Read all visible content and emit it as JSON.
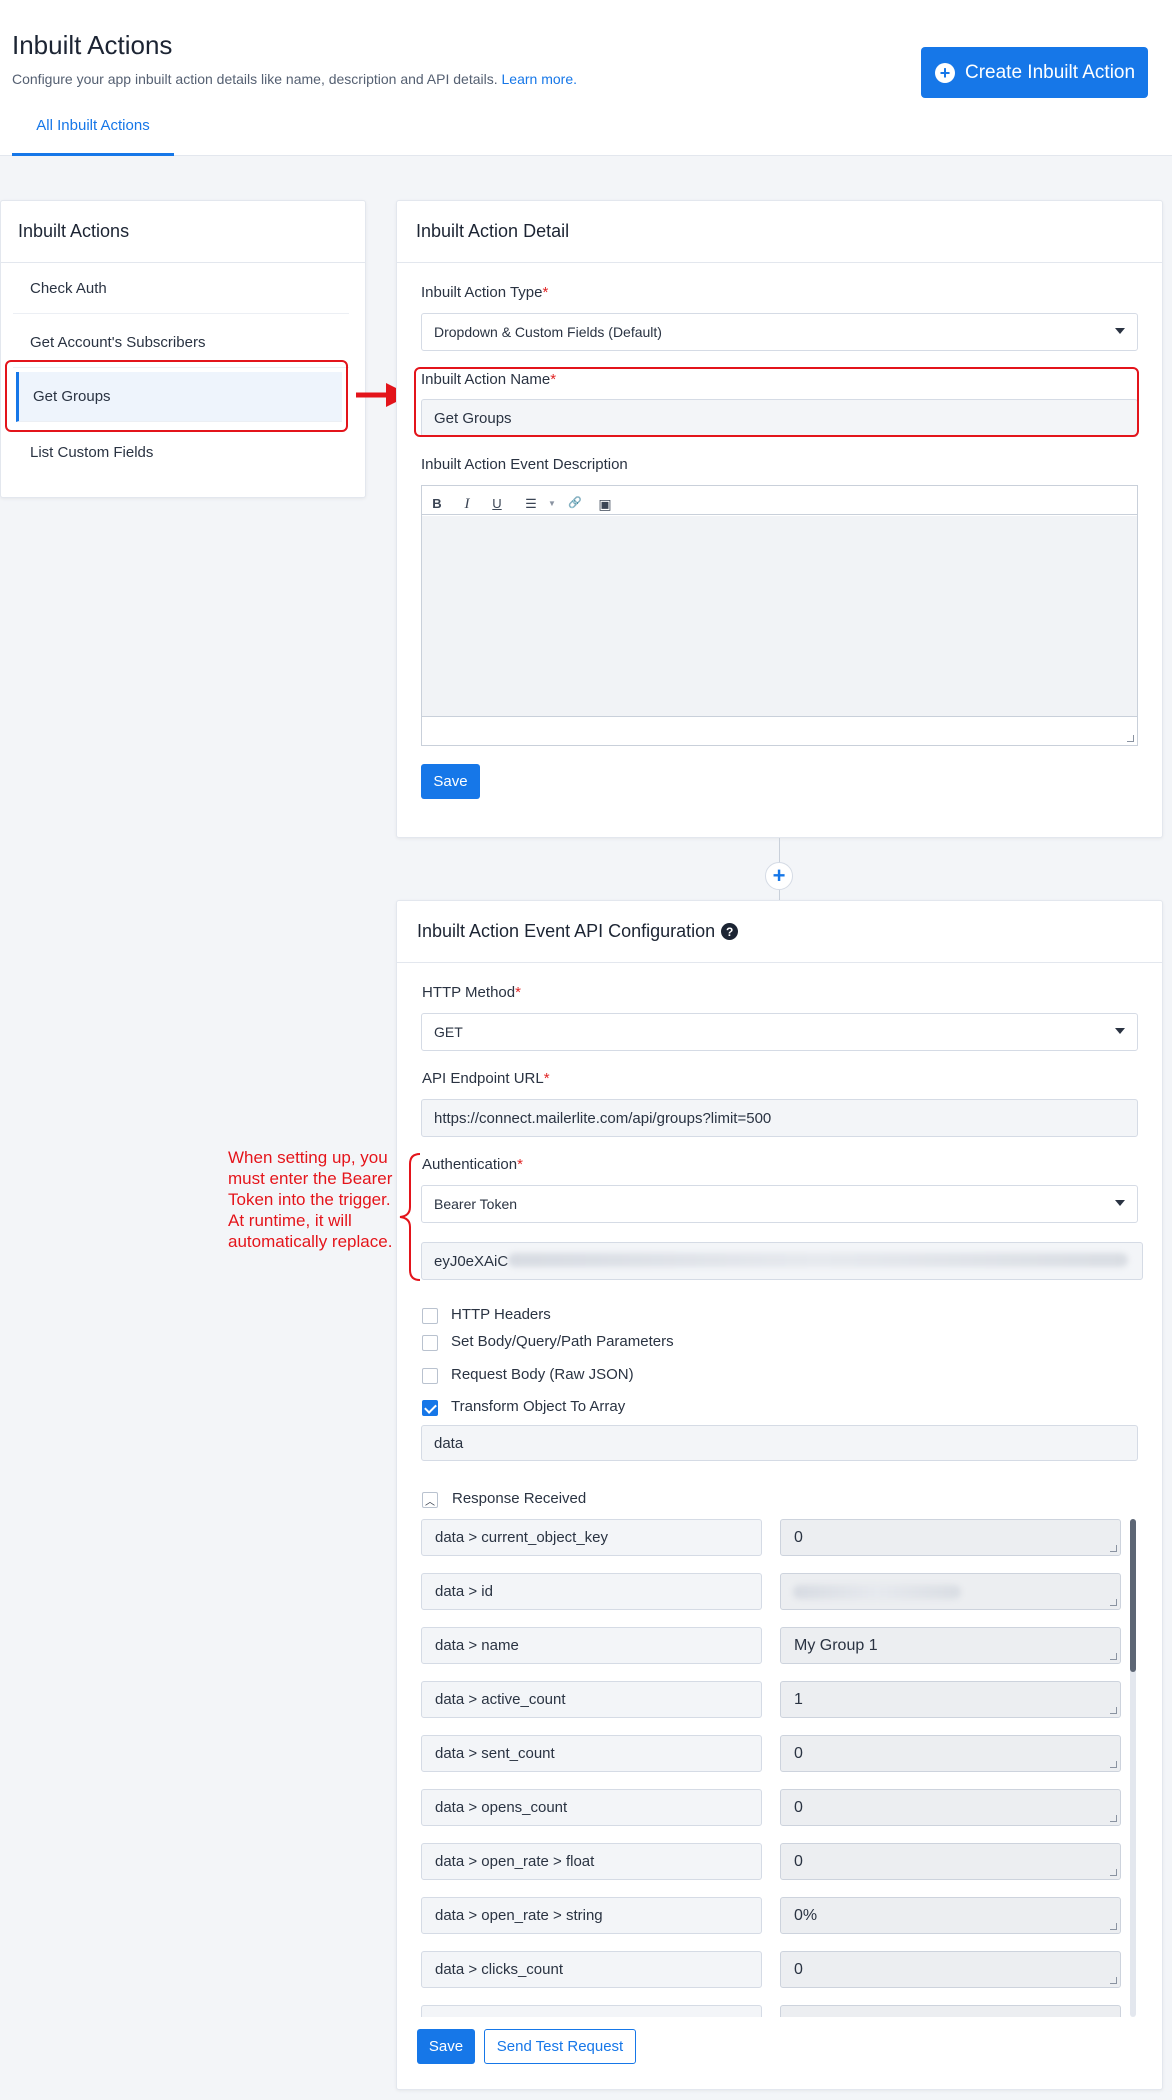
{
  "header": {
    "title": "Inbuilt Actions",
    "description": "Configure your app inbuilt action details like name, description and API details.",
    "learn_more": "Learn more.",
    "tab": "All Inbuilt Actions",
    "create_button": "Create Inbuilt Action"
  },
  "sidebar": {
    "title": "Inbuilt Actions",
    "items": [
      {
        "label": "Check Auth"
      },
      {
        "label": "Get Account's Subscribers"
      },
      {
        "label": "Get Groups"
      },
      {
        "label": "List Custom Fields"
      }
    ]
  },
  "detail": {
    "title": "Inbuilt Action Detail",
    "type_label": "Inbuilt Action Type",
    "type_value": "Dropdown & Custom Fields (Default)",
    "name_label": "Inbuilt Action Name",
    "name_value": "Get Groups",
    "desc_label": "Inbuilt Action Event Description",
    "save": "Save"
  },
  "toolbar": {
    "bold": "B",
    "italic": "I",
    "underline": "U",
    "list": "☰",
    "link": "🔗",
    "image": "▣"
  },
  "add_step": "+",
  "api": {
    "title": "Inbuilt Action Event API Configuration",
    "help_icon": "?",
    "method_label": "HTTP Method",
    "method_value": "GET",
    "url_label": "API Endpoint URL",
    "url_value": "https://connect.mailerlite.com/api/groups?limit=500",
    "auth_label": "Authentication",
    "auth_value": "Bearer Token",
    "token_value": "eyJ0eXAiC",
    "checkboxes": [
      {
        "label": "HTTP Headers"
      },
      {
        "label": "Set Body/Query/Path Parameters"
      },
      {
        "label": "Request Body (Raw JSON)"
      },
      {
        "label": "Transform Object To Array"
      }
    ],
    "transform_value": "data",
    "response_label": "Response Received",
    "response": [
      {
        "key": "data > current_object_key",
        "value": "0"
      },
      {
        "key": "data > id",
        "value": ""
      },
      {
        "key": "data > name",
        "value": "My Group 1"
      },
      {
        "key": "data > active_count",
        "value": "1"
      },
      {
        "key": "data > sent_count",
        "value": "0"
      },
      {
        "key": "data > opens_count",
        "value": "0"
      },
      {
        "key": "data > open_rate > float",
        "value": "0"
      },
      {
        "key": "data > open_rate > string",
        "value": "0%"
      },
      {
        "key": "data > clicks_count",
        "value": "0"
      }
    ],
    "save": "Save",
    "send_test": "Send Test Request"
  },
  "annotation": "When setting up, you must enter the Bearer Token into the trigger. At runtime, it will automatically replace.",
  "colors": {
    "accent": "#1677e8",
    "annotation": "#e3141b",
    "required": "#e02424"
  }
}
